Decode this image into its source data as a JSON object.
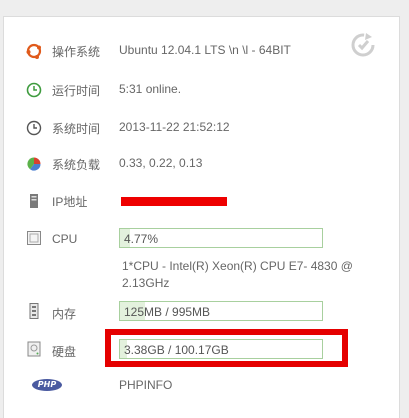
{
  "rows": {
    "os": {
      "label": "操作系统",
      "value": "Ubuntu 12.04.1 LTS \\n \\l - 64BIT"
    },
    "uptime": {
      "label": "运行时间",
      "value": "5:31 online."
    },
    "time": {
      "label": "系统时间",
      "value": "2013-11-22 21:52:12"
    },
    "load": {
      "label": "系统负载",
      "value": "0.33, 0.22, 0.13"
    },
    "ip": {
      "label": "IP地址"
    },
    "cpu": {
      "label": "CPU",
      "value": "4.77%",
      "percent": 4.77,
      "info": "1*CPU - Intel(R) Xeon(R) CPU E7- 4830 @ 2.13GHz"
    },
    "memory": {
      "label": "内存",
      "value": "125MB / 995MB",
      "used_mb": 125,
      "total_mb": 995
    },
    "disk": {
      "label": "硬盘",
      "value": "3.38GB / 100.17GB",
      "used_gb": 3.38,
      "total_gb": 100.17
    },
    "php": {
      "logo": "PHP",
      "value": "PHPINFO"
    }
  },
  "icons": {
    "os": "ubuntu-icon",
    "uptime": "clock-icon",
    "time": "clock-icon",
    "load": "pie-chart-icon",
    "ip": "server-icon",
    "cpu": "cpu-icon",
    "memory": "memory-icon",
    "disk": "disk-icon",
    "php": "php-icon",
    "refresh": "refresh-icon"
  },
  "colors": {
    "bar_border": "#a8d09e",
    "bar_fill": "#e3f1dd",
    "redaction": "#ee0000",
    "highlight": "#e50000"
  }
}
